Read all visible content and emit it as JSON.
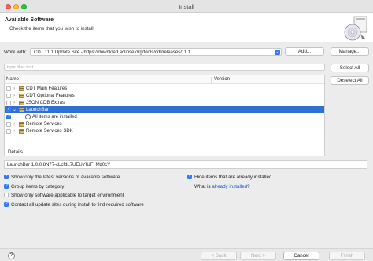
{
  "window": {
    "title": "Install"
  },
  "banner": {
    "title": "Available Software",
    "description": "Check the items that you wish to install.",
    "icon": "install-cd-icon"
  },
  "work_with": {
    "label": "Work with:",
    "value": "CDT 11.1 Update Site - https://download.eclipse.org/tools/cdt/releases/11.1",
    "add_label": "Add...",
    "manage_label": "Manage..."
  },
  "filter": {
    "placeholder": "type filter text"
  },
  "tree": {
    "columns": {
      "name": "Name",
      "version": "Version"
    },
    "rows": [
      {
        "label": "CDT Main Features",
        "checked": false,
        "type": "category",
        "expanded": false
      },
      {
        "label": "CDT Optional Features",
        "checked": false,
        "type": "category",
        "expanded": false
      },
      {
        "label": "JSON CDB Extras",
        "checked": false,
        "type": "category",
        "expanded": false
      },
      {
        "label": "LaunchBar",
        "checked": true,
        "type": "category",
        "expanded": true,
        "selected": true
      },
      {
        "label": "All items are installed",
        "checked": true,
        "type": "info"
      },
      {
        "label": "Remote Services",
        "checked": false,
        "type": "category",
        "expanded": false
      },
      {
        "label": "Remote Services SDK",
        "checked": false,
        "type": "category",
        "expanded": false
      }
    ]
  },
  "side_buttons": {
    "select_all": "Select All",
    "deselect_all": "Deselect All"
  },
  "details": {
    "label": "Details",
    "text": "LaunchBar 1.0.0.8N77-cLcfdL7UEUYIUF_Mz0cY"
  },
  "options": {
    "latest_versions": {
      "label": "Show only the latest versions of available software",
      "checked": true
    },
    "group_by_category": {
      "label": "Group items by category",
      "checked": true
    },
    "target_env": {
      "label": "Show only software applicable to target environment",
      "checked": false
    },
    "contact_sites": {
      "label": "Contact all update sites during install to find required software",
      "checked": true
    },
    "hide_installed": {
      "label": "Hide items that are already installed",
      "checked": true
    },
    "already_installed": {
      "prefix": "What is ",
      "link": "already installed",
      "suffix": "?"
    }
  },
  "footer": {
    "help_icon": "help-icon",
    "back_label": "< Back",
    "next_label": "Next >",
    "cancel_label": "Cancel",
    "finish_label": "Finish"
  },
  "colors": {
    "accent": "#3478f6",
    "selection": "#2f6fd6",
    "link": "#1a55c9"
  }
}
